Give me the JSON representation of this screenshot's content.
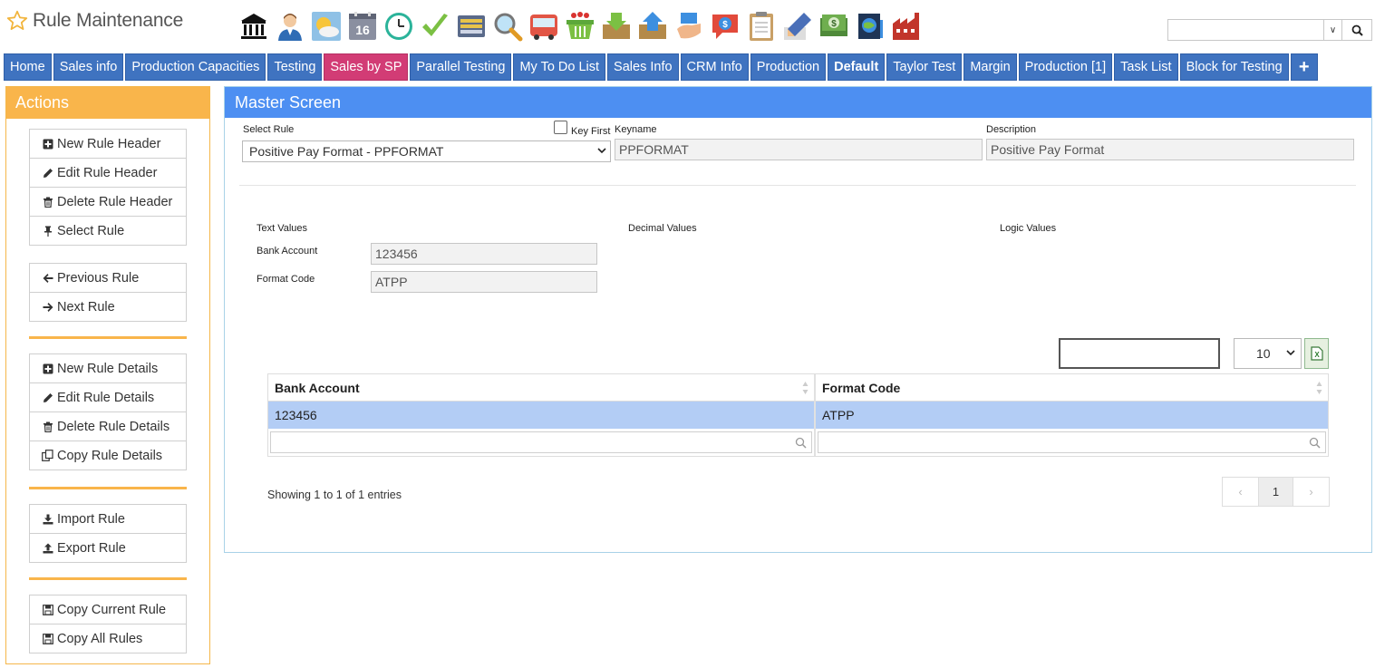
{
  "app": {
    "title": "Rule Maintenance"
  },
  "toolbar": {
    "icons": [
      "bank-icon",
      "user-icon",
      "weather-icon",
      "calendar-icon",
      "clock-icon",
      "checkmark-icon",
      "keyboard-icon",
      "magnifier-icon",
      "bus-icon",
      "basket-icon",
      "download-box-icon",
      "upload-box-icon",
      "hand-icon",
      "money-bubble-icon",
      "clipboard-icon",
      "pencil-icon",
      "cash-icon",
      "globe-book-icon",
      "factory-icon"
    ],
    "calendar_day": "16"
  },
  "search": {
    "value": "",
    "placeholder": ""
  },
  "nav": {
    "tabs": [
      {
        "label": "Home"
      },
      {
        "label": "Sales info"
      },
      {
        "label": "Production Capacities"
      },
      {
        "label": "Testing"
      },
      {
        "label": "Sales by SP"
      },
      {
        "label": "Parallel Testing"
      },
      {
        "label": "My To Do List"
      },
      {
        "label": "Sales Info"
      },
      {
        "label": "CRM Info"
      },
      {
        "label": "Production"
      },
      {
        "label": "Default"
      },
      {
        "label": "Taylor Test"
      },
      {
        "label": "Margin"
      },
      {
        "label": "Production [1]"
      },
      {
        "label": "Task List"
      },
      {
        "label": "Block for Testing"
      }
    ],
    "add_label": "+"
  },
  "actions": {
    "title": "Actions",
    "new_rule_header": "New Rule Header",
    "edit_rule_header": "Edit Rule Header",
    "delete_rule_header": "Delete Rule Header",
    "select_rule": "Select Rule",
    "previous_rule": "Previous Rule",
    "next_rule": "Next Rule",
    "new_rule_details": "New Rule Details",
    "edit_rule_details": "Edit Rule Details",
    "delete_rule_details": "Delete Rule Details",
    "copy_rule_details": "Copy Rule Details",
    "import_rule": "Import Rule",
    "export_rule": "Export Rule",
    "copy_current_rule": "Copy Current Rule",
    "copy_all_rules": "Copy All Rules"
  },
  "master": {
    "title": "Master Screen",
    "select_rule_label": "Select Rule",
    "select_rule_value": "Positive Pay Format - PPFORMAT",
    "key_first_label": "Key First",
    "keyname_label": "Keyname",
    "keyname_value": "PPFORMAT",
    "description_label": "Description",
    "description_value": "Positive Pay Format",
    "text_values_label": "Text Values",
    "decimal_values_label": "Decimal Values",
    "logic_values_label": "Logic Values",
    "bank_account_label": "Bank Account",
    "bank_account_value": "123456",
    "format_code_label": "Format Code",
    "format_code_value": "ATPP"
  },
  "grid": {
    "page_size": "10",
    "columns": [
      "Bank Account",
      "Format Code"
    ],
    "rows": [
      [
        "123456",
        "ATPP"
      ]
    ],
    "showing": "Showing 1 to 1 of 1 entries",
    "pager": {
      "prev": "‹",
      "current": "1",
      "next": "›"
    }
  }
}
